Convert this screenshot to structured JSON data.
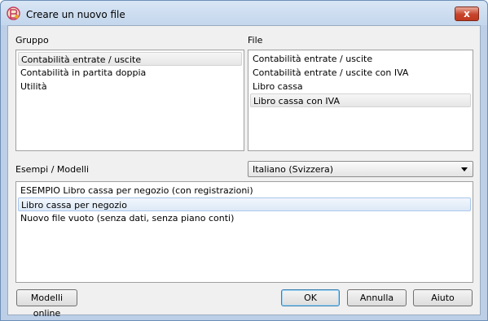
{
  "window": {
    "title": "Creare un nuovo file",
    "close_label": "x"
  },
  "gruppo": {
    "label": "Gruppo",
    "items": [
      "Contabilità entrate / uscite",
      "Contabilità in partita doppia",
      "Utilità"
    ],
    "selected_index": 0
  },
  "file": {
    "label": "File",
    "items": [
      "Contabilità entrate / uscite",
      "Contabilità entrate / uscite con IVA",
      "Libro cassa",
      "Libro cassa con IVA"
    ],
    "selected_index": 3
  },
  "esempi": {
    "label": "Esempi / Modelli",
    "language_selected": "Italiano (Svizzera)",
    "items": [
      "ESEMPIO Libro cassa per negozio (con registrazioni)",
      "Libro cassa per negozio",
      "Nuovo file vuoto (senza dati, senza piano conti)"
    ],
    "selected_index": 1
  },
  "buttons": {
    "online": "Modelli online",
    "ok": "OK",
    "cancel": "Annulla",
    "help": "Aiuto"
  },
  "colors": {
    "accent": "#3c7fb1",
    "close": "#c7432b"
  }
}
